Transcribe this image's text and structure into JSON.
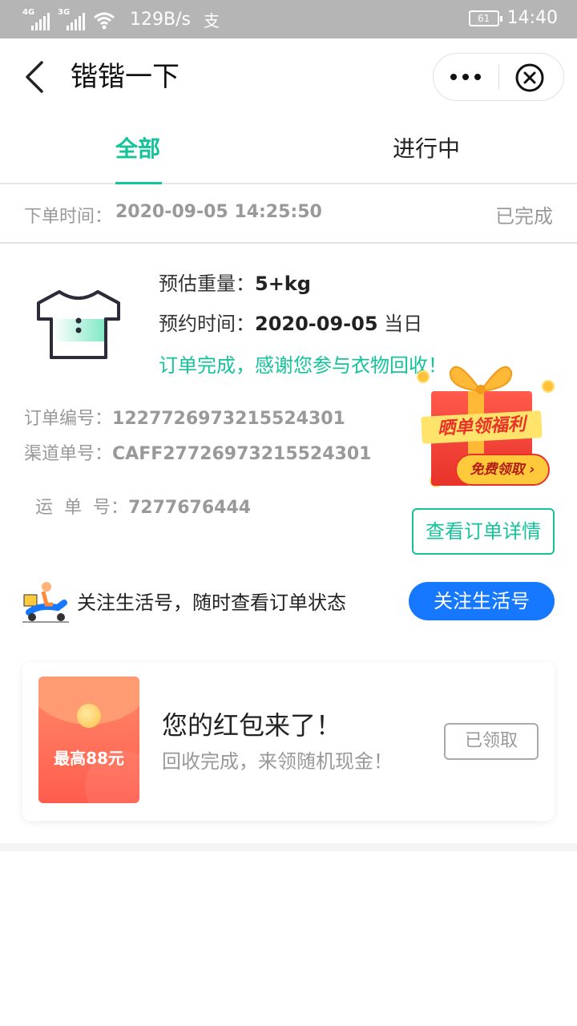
{
  "status_bar": {
    "signal1_tag": "4G",
    "signal2_tag": "3G",
    "net_speed": "129B/s",
    "alipay_glyph": "支",
    "battery": "61",
    "time": "14:40"
  },
  "nav": {
    "title": "锴锴一下"
  },
  "tabs": [
    {
      "label": "全部",
      "active": true
    },
    {
      "label": "进行中",
      "active": false
    }
  ],
  "order": {
    "time_label": "下单时间：",
    "time_value": "2020-09-05 14:25:50",
    "status": "已完成",
    "weight_label": "预估重量：",
    "weight_value": "5+kg",
    "appt_label": "预约时间：",
    "appt_value": "2020-09-05",
    "appt_suffix": " 当日",
    "done_message": "订单完成，感谢您参与衣物回收！",
    "order_no_label": "订单编号：",
    "order_no": "1227726973215524301",
    "channel_no_label": "渠道单号：",
    "channel_no": "CAFF27726973215524301",
    "waybill_label": "运  单  号：",
    "waybill_no": "7277676444",
    "detail_button": "查看订单详情"
  },
  "promo": {
    "banner": "晒单领福利",
    "cta": "免费领取",
    "cta_arrow": "›"
  },
  "follow": {
    "text": "关注生活号，随时查看订单状态",
    "button": "关注生活号"
  },
  "red_packet": {
    "amount": "最高88元",
    "title": "您的红包来了！",
    "subtitle": "回收完成，来领随机现金！",
    "button": "已领取"
  },
  "colors": {
    "accent_green": "#15c39a",
    "follow_blue": "#1677ff",
    "status_bar_gray": "#b5b5b5"
  }
}
